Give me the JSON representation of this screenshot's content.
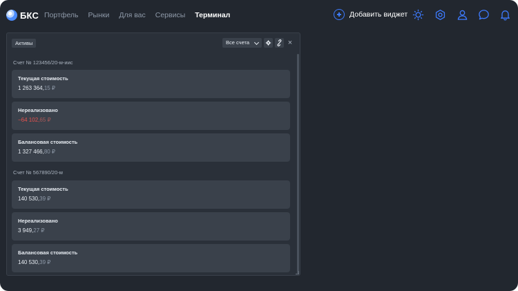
{
  "header": {
    "logo_text": "БКС",
    "nav": [
      {
        "label": "Портфель",
        "active": false
      },
      {
        "label": "Рынки",
        "active": false
      },
      {
        "label": "Для вас",
        "active": false
      },
      {
        "label": "Сервисы",
        "active": false
      },
      {
        "label": "Терминал",
        "active": true
      }
    ],
    "add_widget_label": "Добавить виджет",
    "icons": [
      "sun-icon",
      "settings-icon",
      "profile-icon",
      "chat-icon",
      "bell-icon"
    ],
    "accent_color": "#3d7bff"
  },
  "widget": {
    "tab_label": "Активы",
    "account_select": "Все счета",
    "close_label": "×",
    "tool_icons": [
      "gear-icon",
      "link-icon"
    ],
    "accounts": [
      {
        "title": "Счет № 123456/20-м-иис",
        "rows": [
          {
            "label": "Текущая стоимость",
            "value_int": "1 263 364,",
            "value_frac": "15 ₽",
            "negative": false
          },
          {
            "label": "Нереализовано",
            "value_int": "−64 102,",
            "value_frac": "65 ₽",
            "negative": true
          },
          {
            "label": "Балансовая стоимость",
            "value_int": "1 327 466,",
            "value_frac": "80 ₽",
            "negative": false
          }
        ]
      },
      {
        "title": "Счет № 567890/20-м",
        "rows": [
          {
            "label": "Текущая стоимость",
            "value_int": "140 530,",
            "value_frac": "39 ₽",
            "negative": false
          },
          {
            "label": "Нереализовано",
            "value_int": "3 949,",
            "value_frac": "27 ₽",
            "negative": false
          },
          {
            "label": "Балансовая стоимость",
            "value_int": "140 530,",
            "value_frac": "39 ₽",
            "negative": false
          }
        ]
      }
    ],
    "negative_color": "#e8524f"
  }
}
